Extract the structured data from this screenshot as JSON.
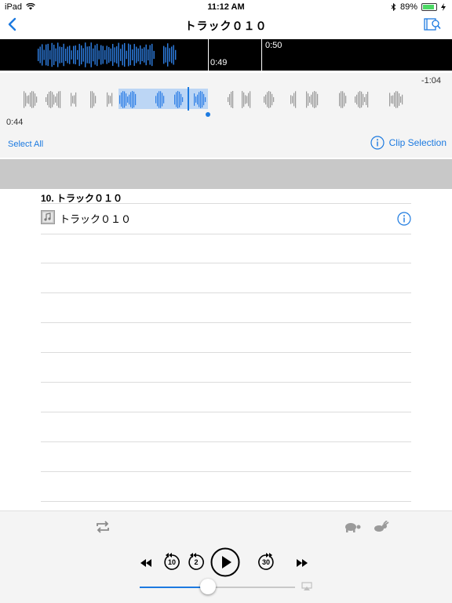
{
  "status_bar": {
    "device": "iPad",
    "time": "11:12 AM",
    "battery": "89%",
    "battery_level": 0.89
  },
  "navbar": {
    "title": "トラック０１０",
    "back_icon": "chevron-left-icon",
    "right_icon": "search-document-icon"
  },
  "waveform_overview": {
    "playhead_time": "0:49",
    "marker_time": "0:50"
  },
  "waveform_detail": {
    "remaining_time": "-1:04",
    "current_time": "0:44"
  },
  "selection_bar": {
    "select_all": "Select All",
    "clip_selection": "Clip Selection"
  },
  "track_list": {
    "section_header": "10. トラック０１０",
    "items": [
      {
        "title": "トラック０１０"
      }
    ]
  },
  "player": {
    "repeat_icon": "repeat-icon",
    "slow_icon": "turtle-icon",
    "fast_icon": "rabbit-icon",
    "skip_back_10": "10",
    "skip_back_2": "2",
    "skip_forward_30": "30",
    "progress": 0.44
  },
  "colors": {
    "accent": "#1c7ae0",
    "waveform_selected": "#2f80e6",
    "waveform_idle": "#9a9a9a"
  }
}
